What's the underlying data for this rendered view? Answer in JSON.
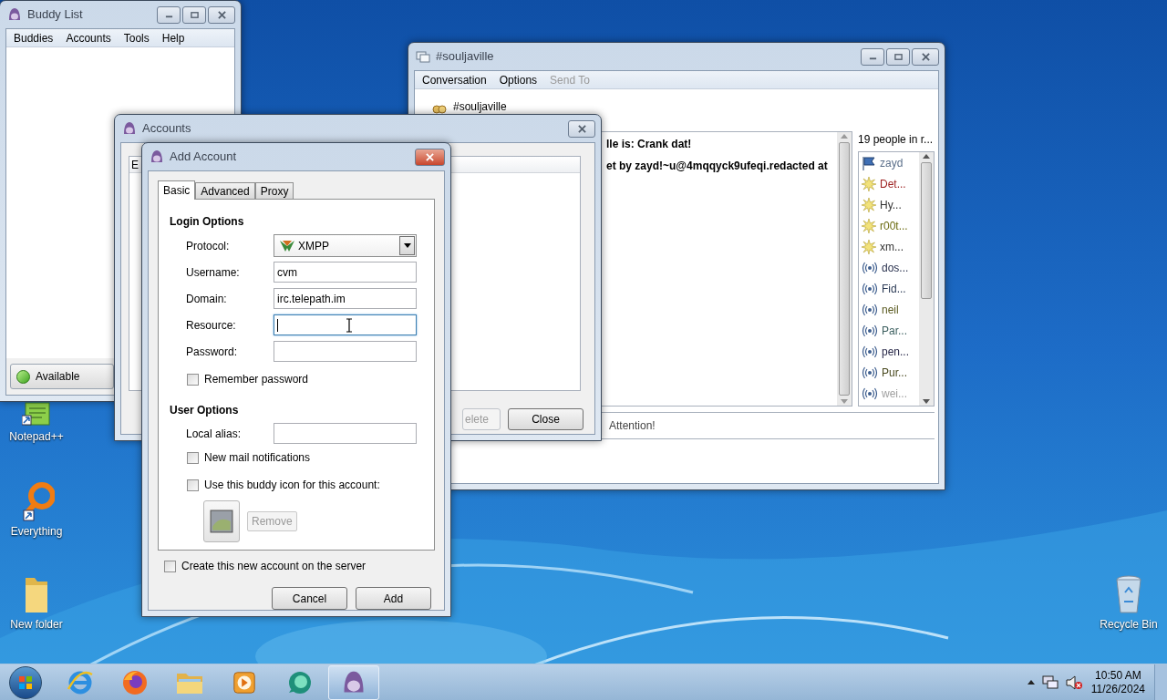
{
  "desktop": {
    "icons": [
      {
        "label": "Notepad++",
        "kind": "notepad"
      },
      {
        "label": "Everything",
        "kind": "search"
      },
      {
        "label": "New folder",
        "kind": "folder"
      },
      {
        "label": "Recycle Bin",
        "kind": "bin"
      }
    ]
  },
  "buddy_list": {
    "title": "Buddy List",
    "menu": [
      "Buddies",
      "Accounts",
      "Tools",
      "Help"
    ],
    "status": "Available"
  },
  "conversation": {
    "title": "#souljaville",
    "menu": [
      {
        "label": "Conversation",
        "disabled": false
      },
      {
        "label": "Options",
        "disabled": false
      },
      {
        "label": "Send To",
        "disabled": true
      }
    ],
    "channel": "#souljaville",
    "messages": [
      "lle is: Crank dat!",
      "et by zayd!~u@4mqqyck9ufeqi.redacted at"
    ],
    "people_count": "19 people in r...",
    "people": [
      {
        "name": "zayd",
        "kind": "op",
        "color": "#5b6f8a"
      },
      {
        "name": "Det...",
        "kind": "voice",
        "color": "#9b1c1c"
      },
      {
        "name": "Hy...",
        "kind": "voice",
        "color": "#333333"
      },
      {
        "name": "r00t...",
        "kind": "voice",
        "color": "#6b6b10"
      },
      {
        "name": "xm...",
        "kind": "voice",
        "color": "#333333"
      },
      {
        "name": "dos...",
        "kind": "member",
        "color": "#2b3350"
      },
      {
        "name": "Fid...",
        "kind": "member",
        "color": "#2b3a55"
      },
      {
        "name": "neil",
        "kind": "member",
        "color": "#5a5a20"
      },
      {
        "name": "Par...",
        "kind": "member",
        "color": "#3d6060"
      },
      {
        "name": "pen...",
        "kind": "member",
        "color": "#2a2a4a"
      },
      {
        "name": "Pur...",
        "kind": "member",
        "color": "#4a4a20"
      },
      {
        "name": "wei...",
        "kind": "member",
        "color": "#a0a0a0"
      }
    ],
    "toolbar_item": "Attention!"
  },
  "accounts": {
    "title": "Accounts",
    "column_1": "E",
    "buttons": [
      {
        "label": "elete",
        "disabled": true
      },
      {
        "label": "Close",
        "disabled": false
      }
    ]
  },
  "add_account": {
    "title": "Add Account",
    "tabs": [
      {
        "label": "Basic",
        "selected": true
      },
      {
        "label": "Advanced",
        "selected": false
      },
      {
        "label": "Proxy",
        "selected": false
      }
    ],
    "login_heading": "Login Options",
    "fields": [
      {
        "label": "Protocol:",
        "kind": "select",
        "value": "XMPP",
        "focused": false
      },
      {
        "label": "Username:",
        "kind": "text",
        "value": "cvm",
        "focused": false
      },
      {
        "label": "Domain:",
        "kind": "text",
        "value": "irc.telepath.im",
        "focused": false
      },
      {
        "label": "Resource:",
        "kind": "text",
        "focused": true
      },
      {
        "label": "Password:",
        "kind": "text",
        "focused": false
      }
    ],
    "remember_password": {
      "label": "Remember password",
      "checked": false
    },
    "user_heading": "User Options",
    "alias_field": {
      "label": "Local alias:"
    },
    "user_checks": [
      {
        "label": "New mail notifications",
        "checked": false
      },
      {
        "label": "Use this buddy icon for this account:",
        "checked": false
      }
    ],
    "remove_button": {
      "label": "Remove",
      "disabled": true
    },
    "create_on_server": {
      "label": "Create this new account on the server",
      "checked": false
    },
    "buttons": [
      "Cancel",
      "Add"
    ]
  },
  "taskbar": {
    "apps": [
      {
        "kind": "browser",
        "selected": false
      },
      {
        "kind": "firefox",
        "selected": false
      },
      {
        "kind": "explorer",
        "selected": false
      },
      {
        "kind": "media",
        "selected": false
      },
      {
        "kind": "chat",
        "selected": false
      },
      {
        "kind": "pidgin",
        "selected": true
      }
    ],
    "time": "10:50 AM",
    "date": "11/26/2024"
  }
}
